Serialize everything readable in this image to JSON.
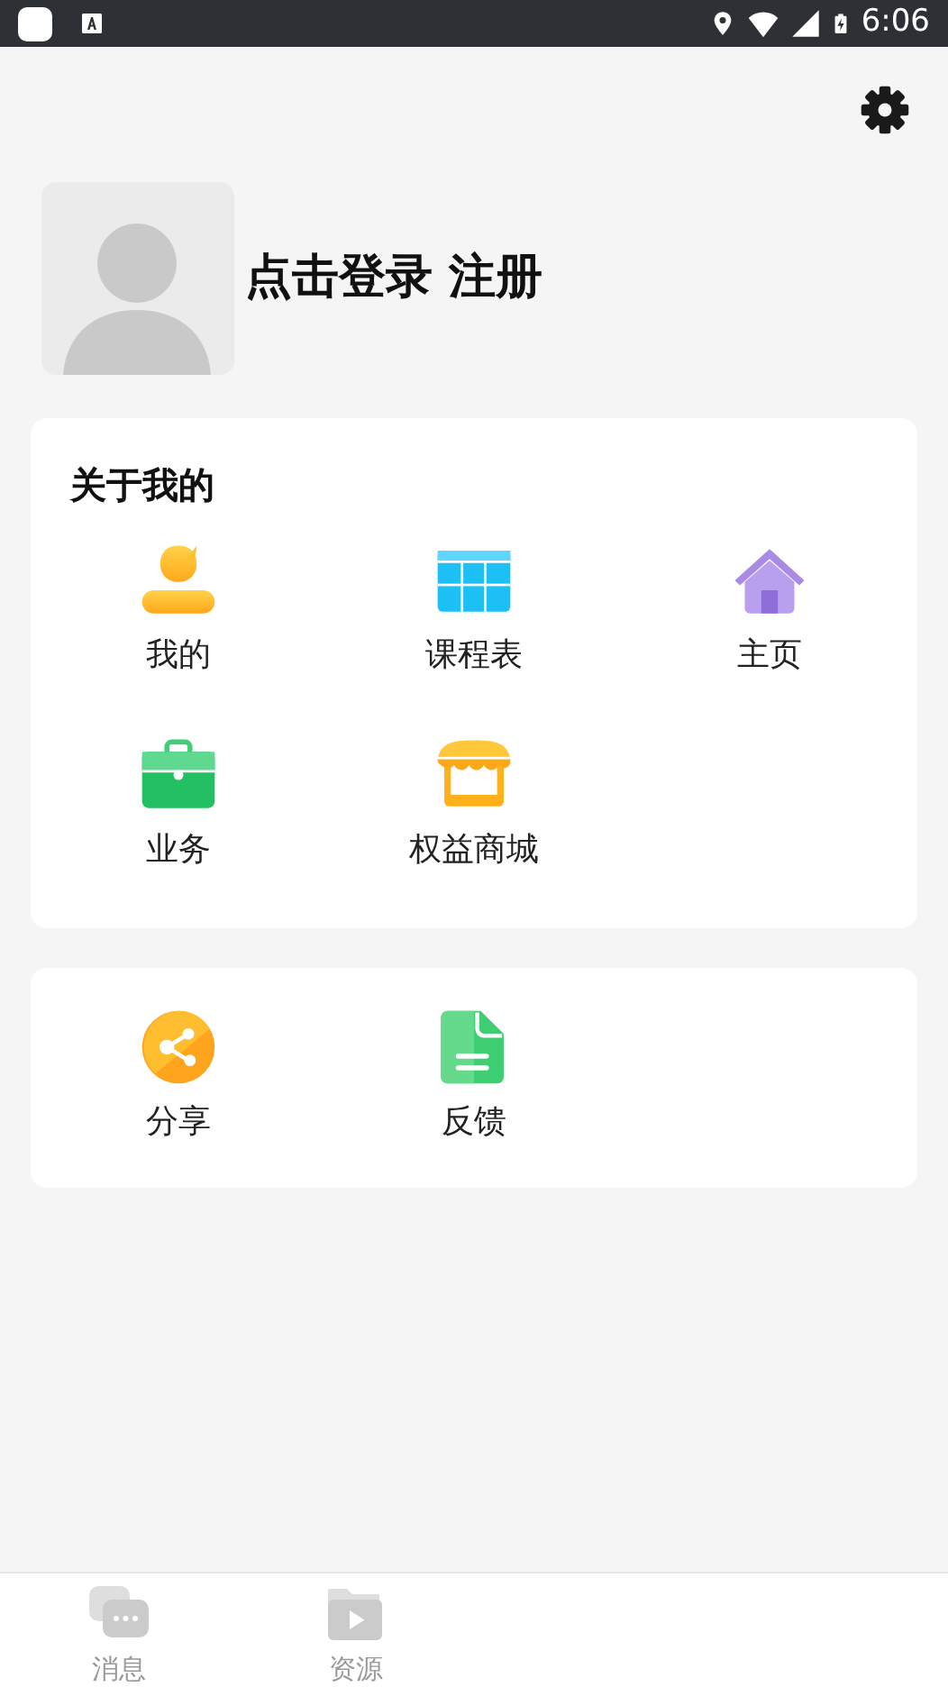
{
  "status_bar": {
    "time": "6:06"
  },
  "profile": {
    "login_text": "点击登录 注册"
  },
  "about_card": {
    "title": "关于我的",
    "items": [
      {
        "label": "我的",
        "kind": "person"
      },
      {
        "label": "课程表",
        "kind": "table"
      },
      {
        "label": "主页",
        "kind": "home"
      },
      {
        "label": "业务",
        "kind": "briefcase"
      },
      {
        "label": "权益商城",
        "kind": "shop"
      }
    ]
  },
  "more_card": {
    "items": [
      {
        "label": "分享",
        "kind": "share"
      },
      {
        "label": "反馈",
        "kind": "document"
      }
    ]
  },
  "bottom_nav": [
    {
      "label": "消息",
      "kind": "chat"
    },
    {
      "label": "资源",
      "kind": "folder"
    }
  ]
}
